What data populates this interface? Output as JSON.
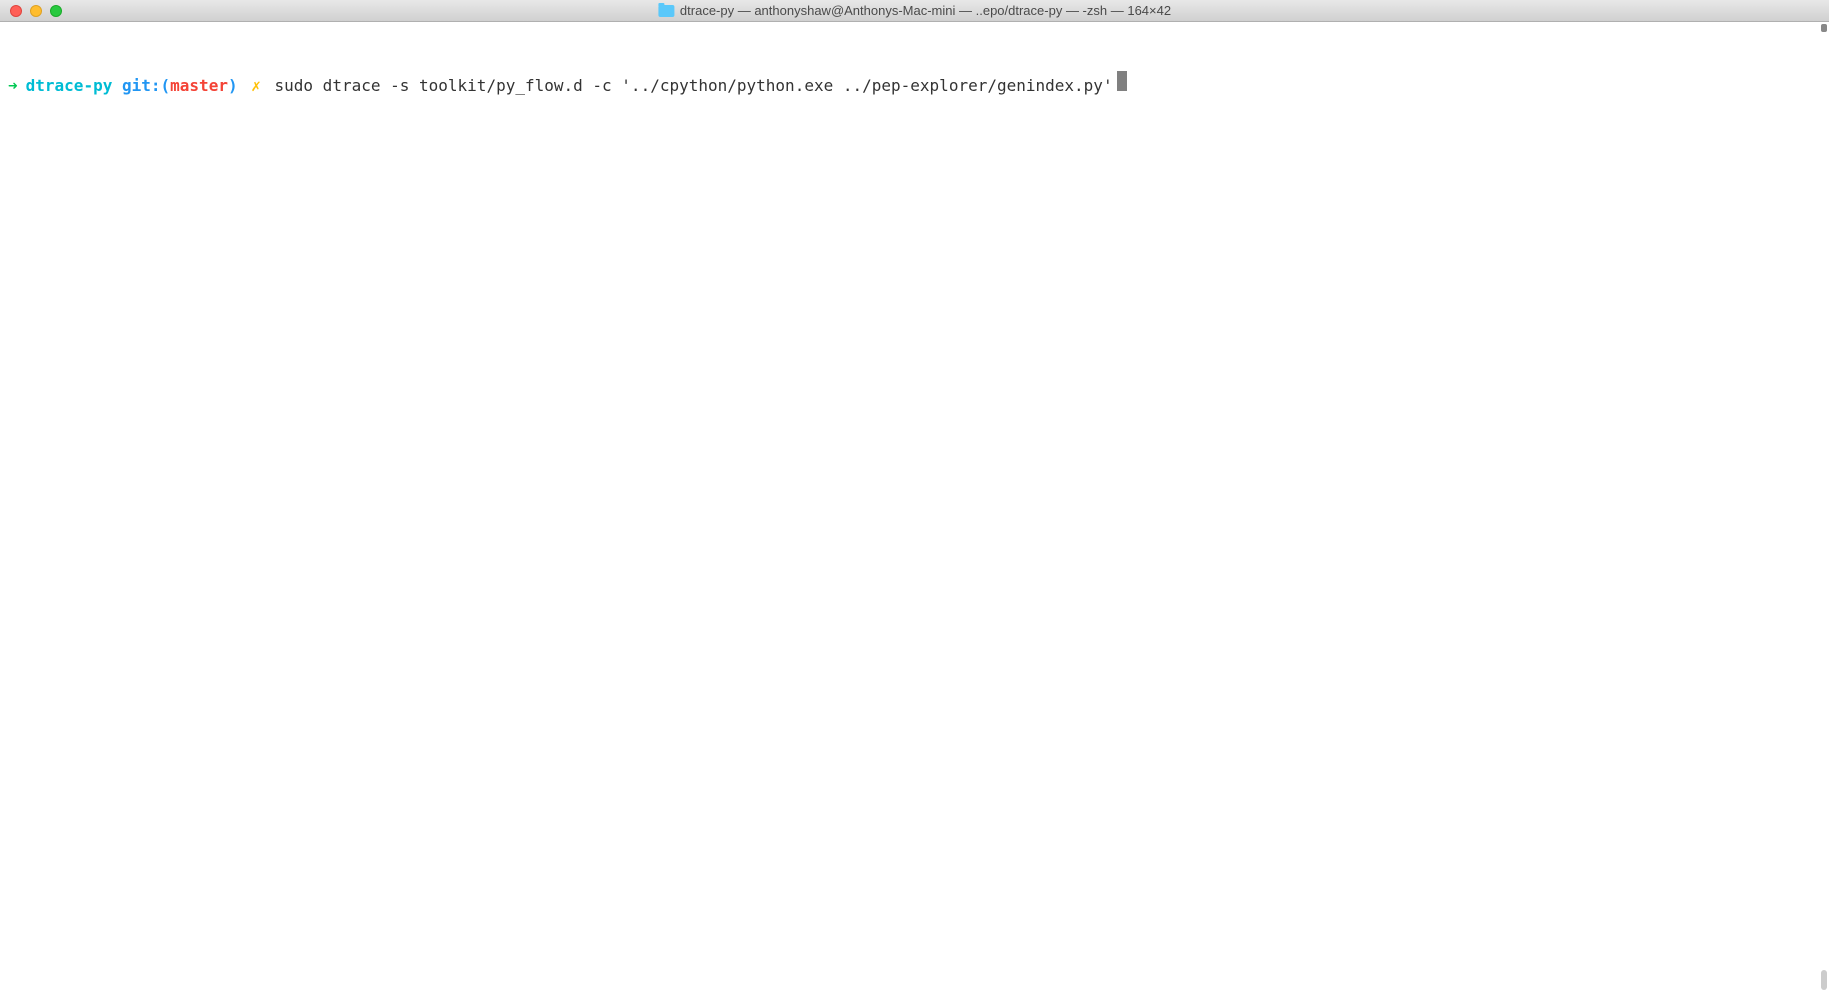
{
  "titlebar": {
    "title": "dtrace-py — anthonyshaw@Anthonys-Mac-mini — ..epo/dtrace-py — -zsh — 164×42"
  },
  "prompt": {
    "arrow": "➜",
    "directory": "dtrace-py",
    "git_prefix": "git:(",
    "git_branch": "master",
    "git_suffix": ")",
    "separator": "✗",
    "command": "sudo dtrace -s toolkit/py_flow.d -c '../cpython/python.exe ../pep-explorer/genindex.py'"
  }
}
